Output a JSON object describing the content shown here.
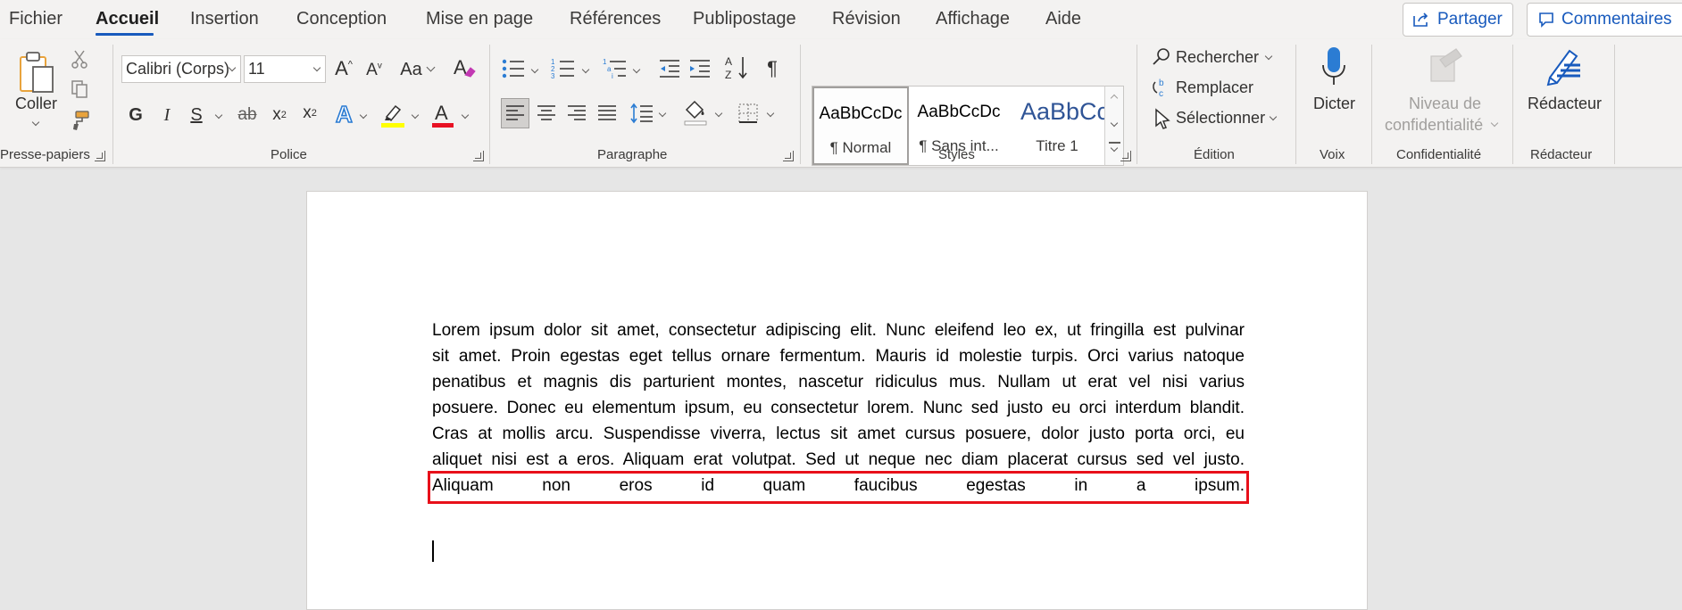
{
  "tabs": [
    {
      "label": "Fichier"
    },
    {
      "label": "Accueil",
      "active": true
    },
    {
      "label": "Insertion"
    },
    {
      "label": "Conception"
    },
    {
      "label": "Mise en page"
    },
    {
      "label": "Références"
    },
    {
      "label": "Publipostage"
    },
    {
      "label": "Révision"
    },
    {
      "label": "Affichage"
    },
    {
      "label": "Aide"
    }
  ],
  "actions": {
    "share": "Partager",
    "comments": "Commentaires"
  },
  "clipboard": {
    "paste": "Coller",
    "group": "Presse-papiers"
  },
  "font": {
    "name": "Calibri (Corps)",
    "size": "11",
    "change_case": "Aa",
    "bold": "G",
    "italic": "I",
    "underline": "S",
    "strike": "ab",
    "subscript": "x",
    "superscript": "x",
    "group": "Police"
  },
  "paragraph": {
    "group": "Paragraphe",
    "pilcrow": "¶"
  },
  "styles": {
    "group": "Styles",
    "items": [
      {
        "sample": "AaBbCcDc",
        "name": "¶ Normal"
      },
      {
        "sample": "AaBbCcDc",
        "name": "¶ Sans int..."
      },
      {
        "sample": "AaBbCc",
        "name": "Titre 1"
      }
    ]
  },
  "editing": {
    "find": "Rechercher",
    "replace": "Remplacer",
    "select": "Sélectionner",
    "group": "Édition"
  },
  "voice": {
    "dictate": "Dicter",
    "group": "Voix"
  },
  "sensitivity": {
    "label_line1": "Niveau de",
    "label_line2": "confidentialité",
    "group": "Confidentialité"
  },
  "editor": {
    "label": "Rédacteur",
    "group": "Rédacteur"
  },
  "document": {
    "lines": [
      "Lorem ipsum dolor sit amet, consectetur adipiscing elit. Nunc eleifend leo ex, ut fringilla est pulvinar",
      "sit amet. Proin egestas eget tellus ornare fermentum. Mauris id molestie turpis. Orci varius natoque",
      "penatibus et magnis dis parturient montes, nascetur ridiculus mus. Nullam ut erat vel nisi varius",
      "posuere. Donec eu elementum ipsum, eu consectetur lorem. Nunc sed justo eu orci interdum blandit.",
      "Cras at mollis arcu. Suspendisse viverra, lectus sit amet cursus posuere, dolor justo porta orci, eu",
      "aliquet nisi est a eros. Aliquam erat volutpat. Sed ut neque nec diam placerat cursus sed vel justo.",
      "Aliquam non eros id quam faucibus egestas in a ipsum."
    ]
  },
  "colors": {
    "accent": "#185abd",
    "highlight_box": "#e8101a",
    "highlighter": "#ffff00",
    "font_color": "#e81123"
  }
}
